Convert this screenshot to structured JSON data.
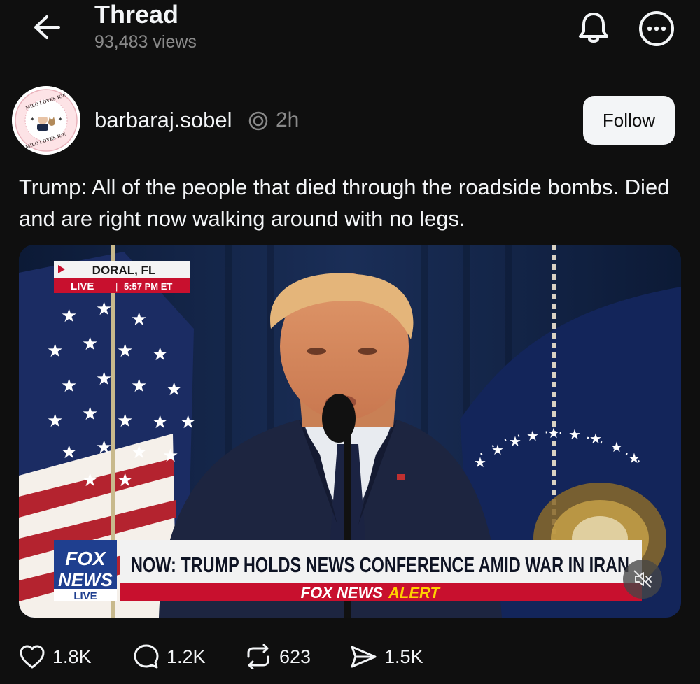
{
  "header": {
    "title": "Thread",
    "views": "93,483 views"
  },
  "post": {
    "username": "barbaraj.sobel",
    "timestamp": "2h",
    "follow_label": "Follow",
    "text": "Trump: All of the people that died through the roadside bombs. Died and are right now walking around with no legs.",
    "avatar_badge_text": "MILO LOVES JOE"
  },
  "video": {
    "location": "DORAL, FL",
    "live_label": "LIVE",
    "live_time": "5:57 PM ET",
    "network_top": "FOX",
    "network_bottom": "NEWS",
    "network_live": "LIVE",
    "headline": "NOW: TRUMP HOLDS NEWS CONFERENCE AMID WAR IN IRAN",
    "alert_prefix": "FOX NEWS",
    "alert_suffix": "ALERT",
    "muted": true
  },
  "actions": {
    "likes": "1.8K",
    "replies": "1.2K",
    "reposts": "623",
    "shares": "1.5K"
  },
  "colors": {
    "background": "#0f0f0f",
    "text": "#f3f5f7",
    "secondary_text": "#8a8a8a",
    "follow_bg": "#f3f5f7",
    "chyron_red": "#c8102e",
    "chyron_blue": "#1f3f8f",
    "alert_yellow": "#ffd200"
  }
}
